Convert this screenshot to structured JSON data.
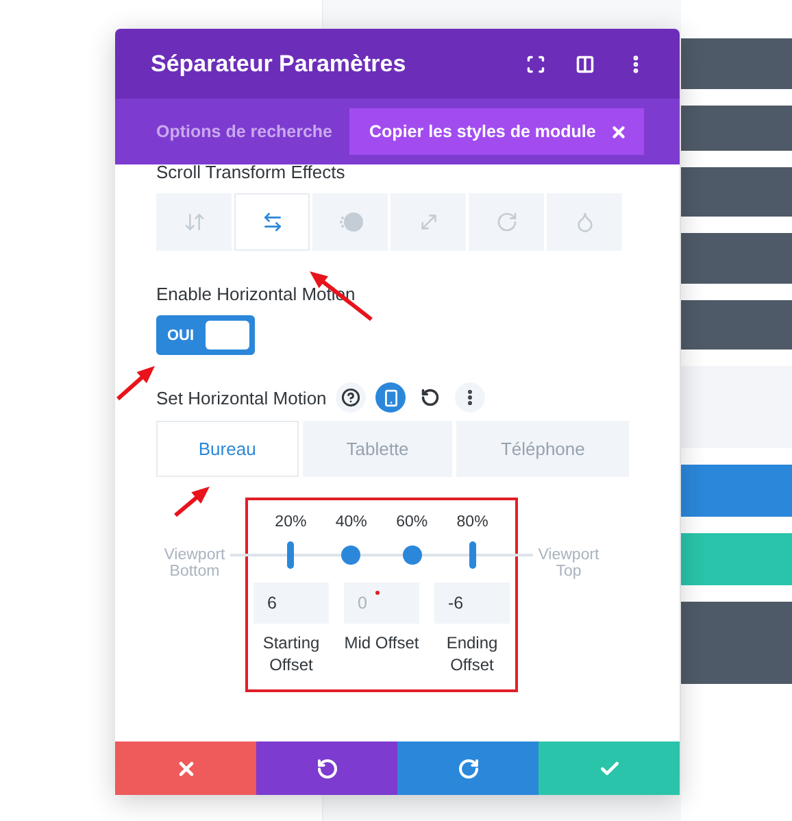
{
  "panel": {
    "title": "Séparateur Paramètres",
    "tabs": [
      {
        "label": "Options de recherche",
        "selected": false,
        "closable": false
      },
      {
        "label": "Copier les styles de module",
        "selected": true,
        "closable": true
      }
    ],
    "effects_label": "Scroll Transform Effects",
    "effects": [
      {
        "kind": "vertical",
        "selected": false
      },
      {
        "kind": "horizontal",
        "selected": true
      },
      {
        "kind": "fade",
        "selected": false
      },
      {
        "kind": "scale",
        "selected": false
      },
      {
        "kind": "rotate",
        "selected": false
      },
      {
        "kind": "blur",
        "selected": false
      }
    ],
    "toggle": {
      "label": "Enable Horizontal Motion",
      "on": true,
      "text": "OUI"
    },
    "motion": {
      "label": "Set Horizontal Motion",
      "devices": [
        {
          "label": "Bureau",
          "selected": true
        },
        {
          "label": "Tablette",
          "selected": false
        },
        {
          "label": "Téléphone",
          "selected": false
        }
      ],
      "left_label": "Viewport Bottom",
      "right_label": "Viewport Top",
      "points": [
        {
          "label": "20%",
          "level": 0.2,
          "kind": "bar"
        },
        {
          "label": "40%",
          "level": 0.4,
          "kind": "dot"
        },
        {
          "label": "60%",
          "level": 0.6,
          "kind": "dot"
        },
        {
          "label": "80%",
          "level": 0.8,
          "kind": "bar"
        }
      ],
      "offsets": [
        {
          "value": "6",
          "label": "Starting Offset",
          "modified": false
        },
        {
          "placeholder": "0",
          "label": "Mid Offset",
          "modified": true
        },
        {
          "value": "-6",
          "label": "Ending Offset",
          "modified": false
        }
      ]
    },
    "footer": [
      {
        "kind": "cancel",
        "color": "#ef5a5a"
      },
      {
        "kind": "undo",
        "color": "#7d3bcf"
      },
      {
        "kind": "redo",
        "color": "#2b87da"
      },
      {
        "kind": "save",
        "color": "#29c4a9"
      }
    ]
  }
}
